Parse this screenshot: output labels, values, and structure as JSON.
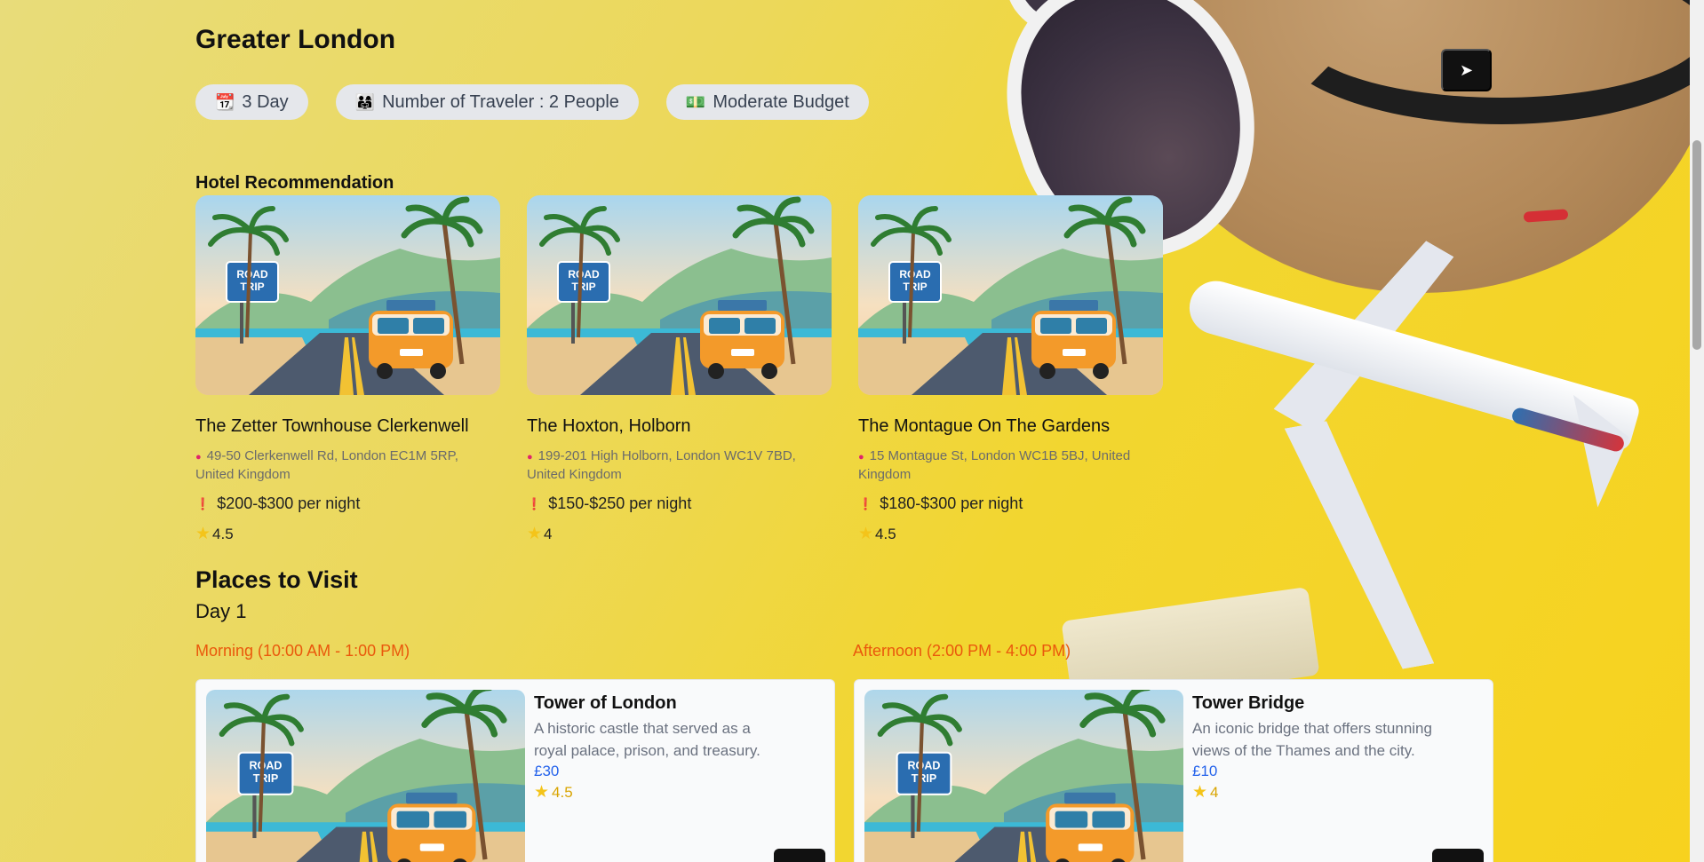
{
  "trip": {
    "location": "Greater London",
    "chips": [
      {
        "icon": "calendar-icon",
        "glyph": "📆",
        "label": "3 Day"
      },
      {
        "icon": "travelers-icon",
        "glyph": "👨‍👩‍👧",
        "label": "Number of Traveler : 2 People"
      },
      {
        "icon": "money-icon",
        "glyph": "💵",
        "label": "Moderate Budget"
      }
    ],
    "share_glyph": "➤"
  },
  "hotels": {
    "heading": "Hotel Recommendation",
    "items": [
      {
        "name": "The Zetter Townhouse Clerkenwell",
        "address": "49-50 Clerkenwell Rd, London EC1M 5RP, United Kingdom",
        "price": "$200-$300 per night",
        "rating": "4.5"
      },
      {
        "name": "The Hoxton, Holborn",
        "address": "199-201 High Holborn, London WC1V 7BD, United Kingdom",
        "price": "$150-$250 per night",
        "rating": "4"
      },
      {
        "name": "The Montague On The Gardens",
        "address": "15 Montague St, London WC1B 5BJ, United Kingdom",
        "price": "$180-$300 per night",
        "rating": "4.5"
      }
    ]
  },
  "places": {
    "heading": "Places to Visit",
    "day": "Day 1",
    "slots": [
      {
        "time": "Morning (10:00 AM - 1:00 PM)",
        "name": "Tower of London",
        "description": "A historic castle that served as a royal palace, prison, and treasury.",
        "price": "£30",
        "rating": "4.5"
      },
      {
        "time": "Afternoon (2:00 PM - 4:00 PM)",
        "name": "Tower Bridge",
        "description": "An iconic bridge that offers stunning views of the Thames and the city.",
        "price": "£10",
        "rating": "4"
      }
    ]
  },
  "image_sign": {
    "line1": "ROAD",
    "line2": "TRIP"
  },
  "icons": {
    "pin": "●",
    "price": "❗",
    "star": "★"
  },
  "colors": {
    "background": "#f2d630",
    "accent_orange": "#ea580c",
    "price_blue": "#2563eb",
    "star": "#f4c41a"
  }
}
